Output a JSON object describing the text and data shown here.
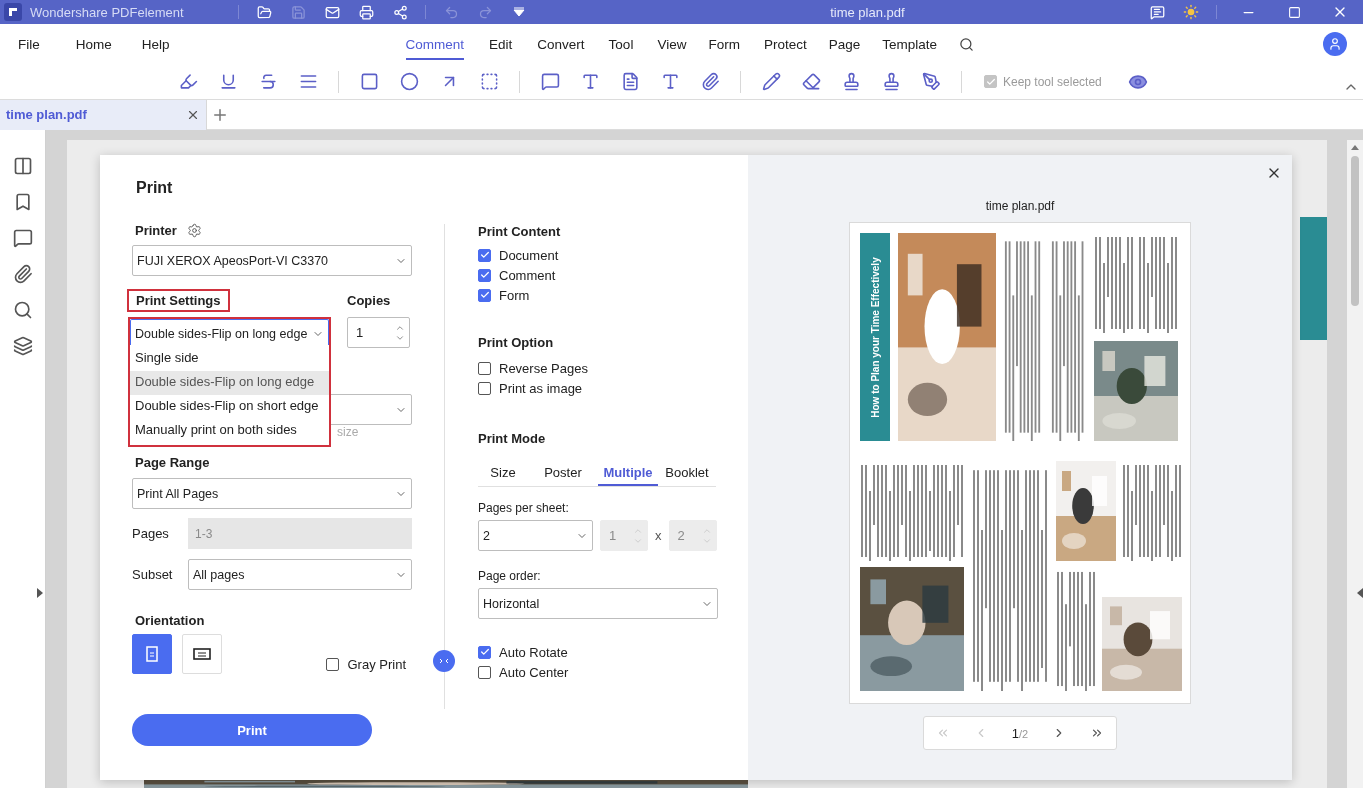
{
  "window": {
    "app_title": "Wondershare PDFelement",
    "doc_title": "time plan.pdf"
  },
  "menu": [
    {
      "label": "File",
      "selected": false
    },
    {
      "label": "Home",
      "selected": false
    },
    {
      "label": "Help",
      "selected": false
    },
    {
      "label": "Comment",
      "selected": true
    },
    {
      "label": "Edit",
      "selected": false
    },
    {
      "label": "Convert",
      "selected": false
    },
    {
      "label": "Tool",
      "selected": false
    },
    {
      "label": "View",
      "selected": false
    },
    {
      "label": "Form",
      "selected": false
    },
    {
      "label": "Protect",
      "selected": false
    },
    {
      "label": "Page",
      "selected": false
    },
    {
      "label": "Template",
      "selected": false
    }
  ],
  "toolbar": {
    "keep_tool_selected": {
      "label": "Keep tool selected",
      "checked": true,
      "disabled": true
    }
  },
  "tabs": [
    {
      "label": "time plan.pdf",
      "selected": true
    }
  ],
  "print_dialog": {
    "title": "Print",
    "printer": {
      "label": "Printer",
      "value": "FUJI XEROX ApeosPort-VI C3370"
    },
    "print_settings": {
      "label": "Print Settings",
      "value": "Double sides-Flip on long edge",
      "expanded": true,
      "highlighted": true,
      "options": [
        {
          "label": "Single side",
          "selected": false
        },
        {
          "label": "Double sides-Flip on long edge",
          "selected": true
        },
        {
          "label": "Double sides-Flip on short edge",
          "selected": false
        },
        {
          "label": "Manually print on both sides",
          "selected": false
        }
      ]
    },
    "hidden_hint": "size",
    "copies": {
      "label": "Copies",
      "value": "1"
    },
    "page_range": {
      "label": "Page Range",
      "value": "Print All Pages"
    },
    "pages": {
      "label": "Pages",
      "placeholder": "1-3",
      "disabled": true
    },
    "subset": {
      "label": "Subset",
      "value": "All pages"
    },
    "orientation": {
      "label": "Orientation",
      "options": [
        {
          "kind": "portrait",
          "selected": true
        },
        {
          "kind": "landscape",
          "selected": false
        }
      ]
    },
    "gray_print": {
      "label": "Gray Print",
      "checked": false
    },
    "print_button": "Print",
    "print_content": {
      "title": "Print Content",
      "items": [
        {
          "label": "Document",
          "checked": true
        },
        {
          "label": "Comment",
          "checked": true
        },
        {
          "label": "Form",
          "checked": true
        }
      ]
    },
    "print_option": {
      "title": "Print Option",
      "items": [
        {
          "label": "Reverse Pages",
          "checked": false
        },
        {
          "label": "Print as image",
          "checked": false
        }
      ]
    },
    "print_mode": {
      "title": "Print Mode",
      "tabs": [
        {
          "label": "Size",
          "selected": false
        },
        {
          "label": "Poster",
          "selected": false
        },
        {
          "label": "Multiple",
          "selected": true
        },
        {
          "label": "Booklet",
          "selected": false
        }
      ]
    },
    "pages_per_sheet": {
      "label": "Pages per sheet:",
      "value": "2",
      "columns": "1",
      "separator": "x",
      "rows": "2"
    },
    "page_order": {
      "label": "Page order:",
      "value": "Horizontal"
    },
    "layout_options": [
      {
        "label": "Auto Rotate",
        "checked": true
      },
      {
        "label": "Auto Center",
        "checked": false
      }
    ],
    "preview": {
      "file_name": "time plan.pdf",
      "headline": "How to Plan your Time Effectively",
      "page": "1",
      "total": "/2"
    }
  }
}
